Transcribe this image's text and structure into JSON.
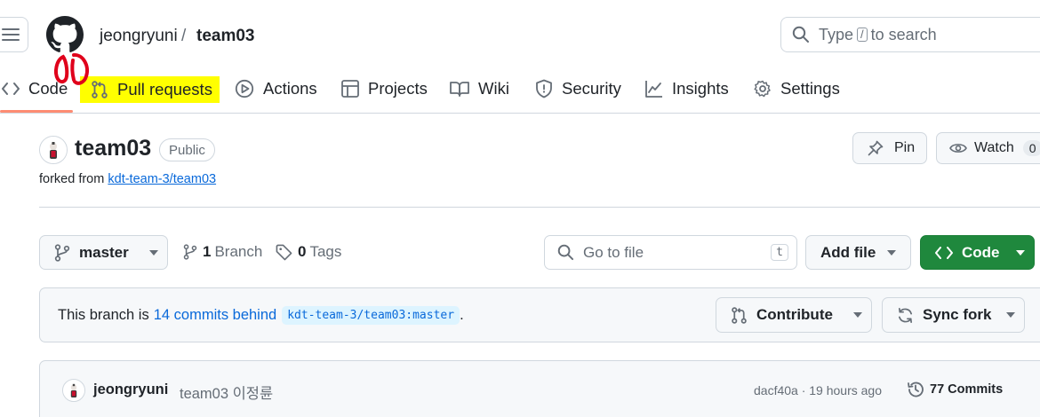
{
  "header": {
    "owner": "jeongryuni",
    "separator": "/",
    "repo": "team03",
    "search_prefix": "Type",
    "search_key": "/",
    "search_suffix": "to search"
  },
  "tabs": [
    {
      "label": "Code",
      "icon": "code-icon",
      "selected": true
    },
    {
      "label": "Pull requests",
      "icon": "git-pull-request-icon",
      "highlighted": true
    },
    {
      "label": "Actions",
      "icon": "play-icon"
    },
    {
      "label": "Projects",
      "icon": "table-icon"
    },
    {
      "label": "Wiki",
      "icon": "book-icon"
    },
    {
      "label": "Security",
      "icon": "shield-icon"
    },
    {
      "label": "Insights",
      "icon": "graph-icon"
    },
    {
      "label": "Settings",
      "icon": "gear-icon"
    }
  ],
  "annotation": {
    "color": "#e0001b"
  },
  "repo": {
    "name": "team03",
    "visibility": "Public",
    "forked_prefix": "forked from",
    "forked_from": "kdt-team-3/team03",
    "pin_label": "Pin",
    "watch_label": "Watch",
    "watch_count": "0"
  },
  "toolbar": {
    "branch": "master",
    "branch_count": "1",
    "branch_label": "Branch",
    "tag_count": "0",
    "tag_label": "Tags",
    "go_to_file_placeholder": "Go to file",
    "go_to_file_key": "t",
    "add_file_label": "Add file",
    "code_label": "Code"
  },
  "branch_status": {
    "prefix": "This branch is",
    "link": "14 commits behind",
    "ref": "kdt-team-3/team03:master",
    "suffix": ".",
    "contribute_label": "Contribute",
    "sync_label": "Sync fork"
  },
  "latest_commit": {
    "author": "jeongryuni",
    "message": "team03 이정륜",
    "hash_time": "dacf40a · 19 hours ago",
    "commits_label": "77 Commits"
  },
  "colors": {
    "accent_green": "#1f883d",
    "link_blue": "#0969da",
    "highlight_yellow": "#ffff00",
    "tab_underline": "#fd8c73"
  }
}
